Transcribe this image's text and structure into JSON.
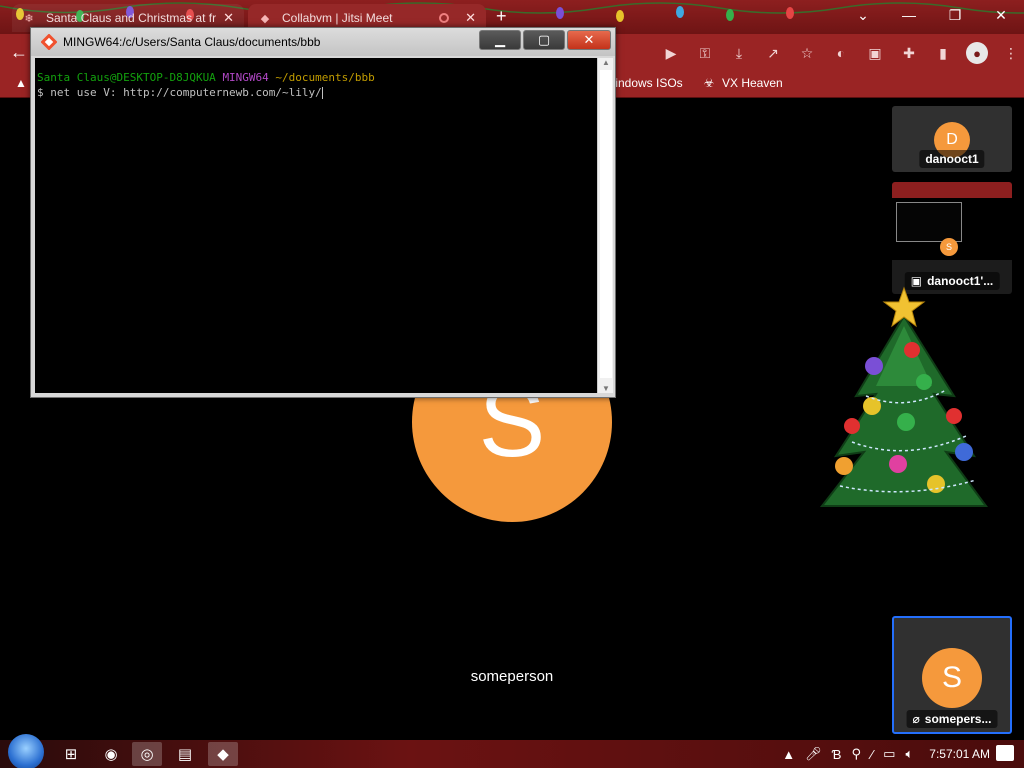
{
  "browser": {
    "tabs": [
      {
        "title": "Santa Claus and Christmas at fr",
        "close": "✕"
      },
      {
        "title": "Collabvm | Jitsi Meet",
        "close": "✕"
      }
    ],
    "new_tab": "+",
    "window_controls": {
      "minimize": "—",
      "maximize": "❐",
      "close": "✕"
    },
    "bookmarks": [
      {
        "label": "Windows ISOs",
        "icon": "windows-icon"
      },
      {
        "label": "VX Heaven",
        "icon": "biohazard-icon"
      }
    ]
  },
  "terminal": {
    "title": "MINGW64:/c/Users/Santa Claus/documents/bbb",
    "prompt_user": "Santa Claus@DESKTOP-D8JQKUA",
    "prompt_env": "MINGW64",
    "prompt_path": "~/documents/bbb",
    "command_line": "$ net use V: http://computernewb.com/~lily/"
  },
  "meeting": {
    "main_initial": "S",
    "main_name": "someperson",
    "thumbnails": [
      {
        "initial": "D",
        "name": "danooct1"
      },
      {
        "initial": "S",
        "name": "danooct1'..."
      },
      {
        "initial": "S",
        "name": "somepers..."
      }
    ]
  },
  "taskbar": {
    "clock": "7:57:01 AM"
  },
  "colors": {
    "avatar_orange": "#f5993c",
    "chrome_red": "#9a2424",
    "active_thumb_border": "#246ffc"
  }
}
